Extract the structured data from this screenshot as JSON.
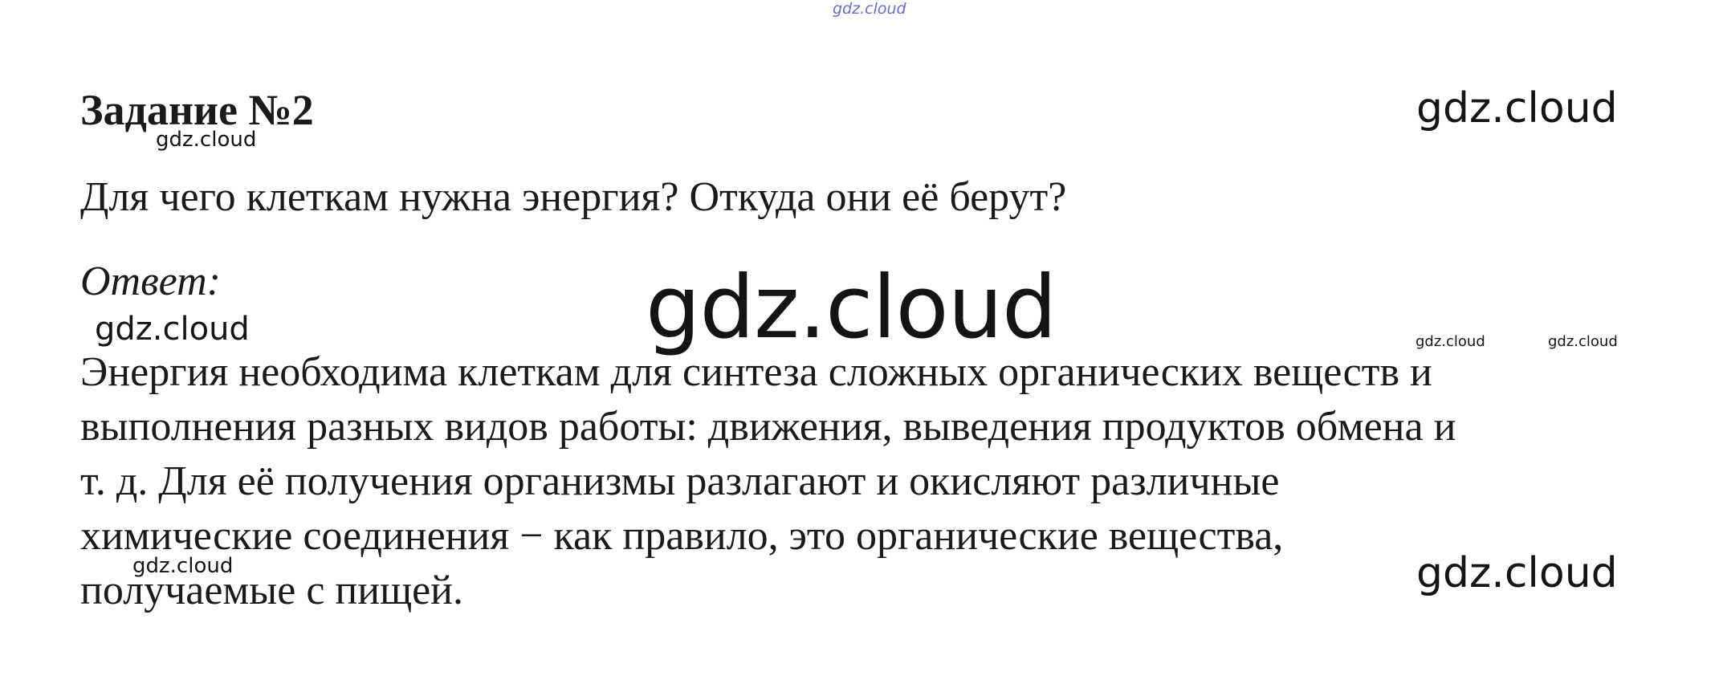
{
  "watermarks": {
    "top": "gdz.cloud",
    "big": "gdz.cloud",
    "large_right_top": "gdz.cloud",
    "large_right_bottom": "gdz.cloud",
    "medium_left": "gdz.cloud",
    "small_under_title": "gdz.cloud",
    "small_lower_left": "gdz.cloud",
    "tiny_right_1": "gdz.cloud",
    "tiny_right_2": "gdz.cloud"
  },
  "task": {
    "title": "Задание №2",
    "question": "Для чего клеткам нужна энергия? Откуда они её берут?",
    "answer_label": "Ответ:",
    "answer_lines": [
      "Энергия необходима клеткам для синтеза сложных органических веществ и",
      "выполнения разных видов работы: движения, выведения продуктов обмена и",
      "т. д. Для её получения организмы разлагают и окисляют различные",
      "химические соединения − как правило, это органические вещества,",
      "получаемые с пищей."
    ]
  }
}
